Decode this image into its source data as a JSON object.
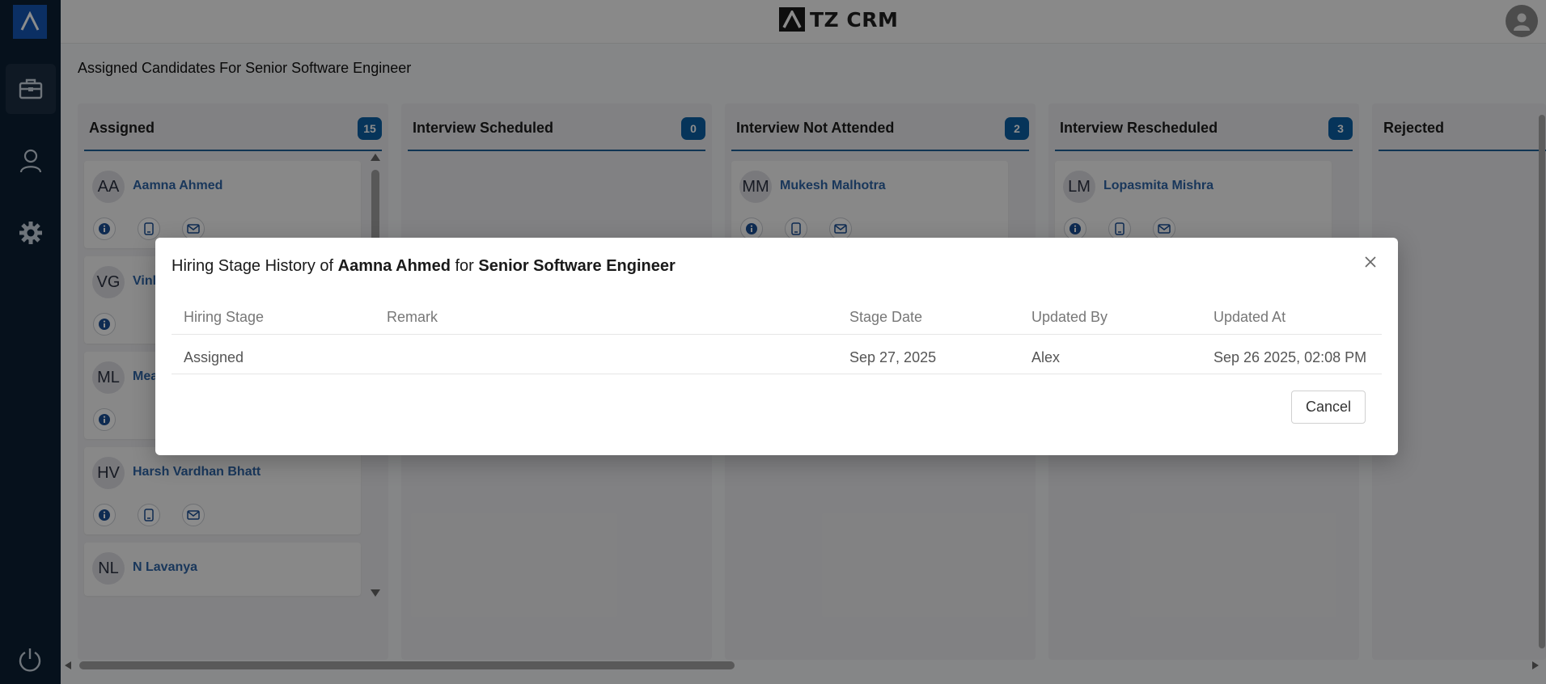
{
  "app": {
    "brand": "TZ CRM",
    "page_title": "Assigned Candidates For Senior Software Engineer"
  },
  "sidebar": {
    "items": [
      {
        "name": "jobs",
        "icon": "briefcase-icon",
        "active": true
      },
      {
        "name": "users",
        "icon": "user-icon",
        "active": false
      },
      {
        "name": "settings",
        "icon": "gear-icon",
        "active": false
      }
    ],
    "bottom_icon": "power-icon"
  },
  "board": {
    "columns": [
      {
        "title": "Assigned",
        "count": "15",
        "cards": [
          {
            "initials": "AA",
            "name": "Aamna Ahmed",
            "actions": [
              "info-icon",
              "phone-icon",
              "mail-icon"
            ]
          },
          {
            "initials": "VG",
            "name": "Vinl",
            "actions": [
              "info-icon"
            ]
          },
          {
            "initials": "ML",
            "name": "Mea",
            "actions": [
              "info-icon"
            ]
          },
          {
            "initials": "HV",
            "name": "Harsh Vardhan Bhatt",
            "actions": [
              "info-icon",
              "phone-icon",
              "mail-icon"
            ]
          },
          {
            "initials": "NL",
            "name": "N Lavanya",
            "actions": []
          }
        ]
      },
      {
        "title": "Interview Scheduled",
        "count": "0",
        "cards": []
      },
      {
        "title": "Interview Not Attended",
        "count": "2",
        "cards": [
          {
            "initials": "MM",
            "name": "Mukesh Malhotra",
            "actions": [
              "info-icon",
              "phone-icon",
              "mail-icon"
            ]
          }
        ]
      },
      {
        "title": "Interview Rescheduled",
        "count": "3",
        "cards": [
          {
            "initials": "LM",
            "name": "Lopasmita Mishra",
            "actions": [
              "info-icon",
              "phone-icon",
              "mail-icon"
            ]
          }
        ]
      },
      {
        "title": "Rejected",
        "count": "",
        "cards": []
      }
    ]
  },
  "modal": {
    "title_prefix": "Hiring Stage History of ",
    "candidate": "Aamna Ahmed",
    "title_mid": " for ",
    "job": "Senior Software Engineer",
    "table": {
      "headers": [
        "Hiring Stage",
        "Remark",
        "Stage Date",
        "Updated By",
        "Updated At"
      ],
      "rows": [
        [
          "Assigned",
          "",
          "Sep 27, 2025",
          "Alex",
          "Sep 26 2025, 02:08 PM"
        ]
      ]
    },
    "cancel_label": "Cancel"
  },
  "colors": {
    "sidebar_bg": "#0b1f33",
    "accent": "#0b5fa5",
    "name_link": "#2f65a7"
  }
}
